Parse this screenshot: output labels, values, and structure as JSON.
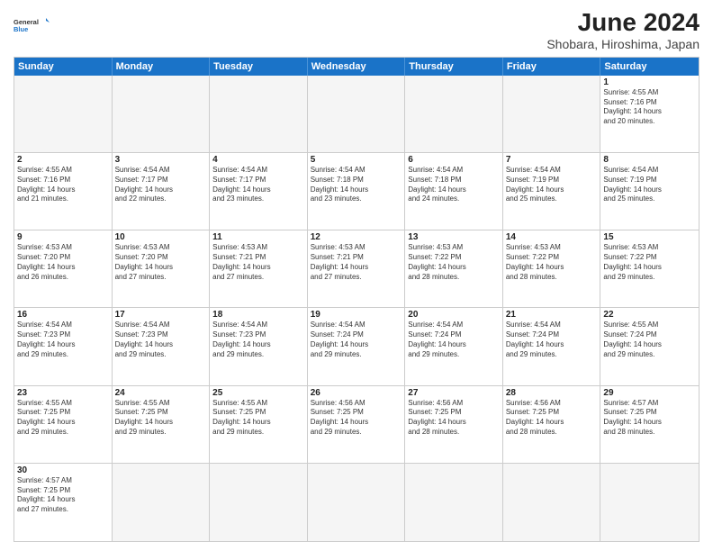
{
  "header": {
    "logo_general": "General",
    "logo_blue": "Blue",
    "month_year": "June 2024",
    "location": "Shobara, Hiroshima, Japan"
  },
  "day_headers": [
    "Sunday",
    "Monday",
    "Tuesday",
    "Wednesday",
    "Thursday",
    "Friday",
    "Saturday"
  ],
  "weeks": [
    [
      {
        "day": "",
        "empty": true,
        "lines": []
      },
      {
        "day": "",
        "empty": true,
        "lines": []
      },
      {
        "day": "",
        "empty": true,
        "lines": []
      },
      {
        "day": "",
        "empty": true,
        "lines": []
      },
      {
        "day": "",
        "empty": true,
        "lines": []
      },
      {
        "day": "",
        "empty": true,
        "lines": []
      },
      {
        "day": "1",
        "empty": false,
        "lines": [
          "Sunrise: 4:55 AM",
          "Sunset: 7:16 PM",
          "Daylight: 14 hours",
          "and 20 minutes."
        ]
      }
    ],
    [
      {
        "day": "2",
        "empty": false,
        "lines": [
          "Sunrise: 4:55 AM",
          "Sunset: 7:16 PM",
          "Daylight: 14 hours",
          "and 21 minutes."
        ]
      },
      {
        "day": "3",
        "empty": false,
        "lines": [
          "Sunrise: 4:54 AM",
          "Sunset: 7:17 PM",
          "Daylight: 14 hours",
          "and 22 minutes."
        ]
      },
      {
        "day": "4",
        "empty": false,
        "lines": [
          "Sunrise: 4:54 AM",
          "Sunset: 7:17 PM",
          "Daylight: 14 hours",
          "and 23 minutes."
        ]
      },
      {
        "day": "5",
        "empty": false,
        "lines": [
          "Sunrise: 4:54 AM",
          "Sunset: 7:18 PM",
          "Daylight: 14 hours",
          "and 23 minutes."
        ]
      },
      {
        "day": "6",
        "empty": false,
        "lines": [
          "Sunrise: 4:54 AM",
          "Sunset: 7:18 PM",
          "Daylight: 14 hours",
          "and 24 minutes."
        ]
      },
      {
        "day": "7",
        "empty": false,
        "lines": [
          "Sunrise: 4:54 AM",
          "Sunset: 7:19 PM",
          "Daylight: 14 hours",
          "and 25 minutes."
        ]
      },
      {
        "day": "8",
        "empty": false,
        "lines": [
          "Sunrise: 4:54 AM",
          "Sunset: 7:19 PM",
          "Daylight: 14 hours",
          "and 25 minutes."
        ]
      }
    ],
    [
      {
        "day": "9",
        "empty": false,
        "lines": [
          "Sunrise: 4:53 AM",
          "Sunset: 7:20 PM",
          "Daylight: 14 hours",
          "and 26 minutes."
        ]
      },
      {
        "day": "10",
        "empty": false,
        "lines": [
          "Sunrise: 4:53 AM",
          "Sunset: 7:20 PM",
          "Daylight: 14 hours",
          "and 27 minutes."
        ]
      },
      {
        "day": "11",
        "empty": false,
        "lines": [
          "Sunrise: 4:53 AM",
          "Sunset: 7:21 PM",
          "Daylight: 14 hours",
          "and 27 minutes."
        ]
      },
      {
        "day": "12",
        "empty": false,
        "lines": [
          "Sunrise: 4:53 AM",
          "Sunset: 7:21 PM",
          "Daylight: 14 hours",
          "and 27 minutes."
        ]
      },
      {
        "day": "13",
        "empty": false,
        "lines": [
          "Sunrise: 4:53 AM",
          "Sunset: 7:22 PM",
          "Daylight: 14 hours",
          "and 28 minutes."
        ]
      },
      {
        "day": "14",
        "empty": false,
        "lines": [
          "Sunrise: 4:53 AM",
          "Sunset: 7:22 PM",
          "Daylight: 14 hours",
          "and 28 minutes."
        ]
      },
      {
        "day": "15",
        "empty": false,
        "lines": [
          "Sunrise: 4:53 AM",
          "Sunset: 7:22 PM",
          "Daylight: 14 hours",
          "and 29 minutes."
        ]
      }
    ],
    [
      {
        "day": "16",
        "empty": false,
        "lines": [
          "Sunrise: 4:54 AM",
          "Sunset: 7:23 PM",
          "Daylight: 14 hours",
          "and 29 minutes."
        ]
      },
      {
        "day": "17",
        "empty": false,
        "lines": [
          "Sunrise: 4:54 AM",
          "Sunset: 7:23 PM",
          "Daylight: 14 hours",
          "and 29 minutes."
        ]
      },
      {
        "day": "18",
        "empty": false,
        "lines": [
          "Sunrise: 4:54 AM",
          "Sunset: 7:23 PM",
          "Daylight: 14 hours",
          "and 29 minutes."
        ]
      },
      {
        "day": "19",
        "empty": false,
        "lines": [
          "Sunrise: 4:54 AM",
          "Sunset: 7:24 PM",
          "Daylight: 14 hours",
          "and 29 minutes."
        ]
      },
      {
        "day": "20",
        "empty": false,
        "lines": [
          "Sunrise: 4:54 AM",
          "Sunset: 7:24 PM",
          "Daylight: 14 hours",
          "and 29 minutes."
        ]
      },
      {
        "day": "21",
        "empty": false,
        "lines": [
          "Sunrise: 4:54 AM",
          "Sunset: 7:24 PM",
          "Daylight: 14 hours",
          "and 29 minutes."
        ]
      },
      {
        "day": "22",
        "empty": false,
        "lines": [
          "Sunrise: 4:55 AM",
          "Sunset: 7:24 PM",
          "Daylight: 14 hours",
          "and 29 minutes."
        ]
      }
    ],
    [
      {
        "day": "23",
        "empty": false,
        "lines": [
          "Sunrise: 4:55 AM",
          "Sunset: 7:25 PM",
          "Daylight: 14 hours",
          "and 29 minutes."
        ]
      },
      {
        "day": "24",
        "empty": false,
        "lines": [
          "Sunrise: 4:55 AM",
          "Sunset: 7:25 PM",
          "Daylight: 14 hours",
          "and 29 minutes."
        ]
      },
      {
        "day": "25",
        "empty": false,
        "lines": [
          "Sunrise: 4:55 AM",
          "Sunset: 7:25 PM",
          "Daylight: 14 hours",
          "and 29 minutes."
        ]
      },
      {
        "day": "26",
        "empty": false,
        "lines": [
          "Sunrise: 4:56 AM",
          "Sunset: 7:25 PM",
          "Daylight: 14 hours",
          "and 29 minutes."
        ]
      },
      {
        "day": "27",
        "empty": false,
        "lines": [
          "Sunrise: 4:56 AM",
          "Sunset: 7:25 PM",
          "Daylight: 14 hours",
          "and 28 minutes."
        ]
      },
      {
        "day": "28",
        "empty": false,
        "lines": [
          "Sunrise: 4:56 AM",
          "Sunset: 7:25 PM",
          "Daylight: 14 hours",
          "and 28 minutes."
        ]
      },
      {
        "day": "29",
        "empty": false,
        "lines": [
          "Sunrise: 4:57 AM",
          "Sunset: 7:25 PM",
          "Daylight: 14 hours",
          "and 28 minutes."
        ]
      }
    ],
    [
      {
        "day": "30",
        "empty": false,
        "lines": [
          "Sunrise: 4:57 AM",
          "Sunset: 7:25 PM",
          "Daylight: 14 hours",
          "and 27 minutes."
        ]
      },
      {
        "day": "",
        "empty": true,
        "lines": []
      },
      {
        "day": "",
        "empty": true,
        "lines": []
      },
      {
        "day": "",
        "empty": true,
        "lines": []
      },
      {
        "day": "",
        "empty": true,
        "lines": []
      },
      {
        "day": "",
        "empty": true,
        "lines": []
      },
      {
        "day": "",
        "empty": true,
        "lines": []
      }
    ]
  ]
}
